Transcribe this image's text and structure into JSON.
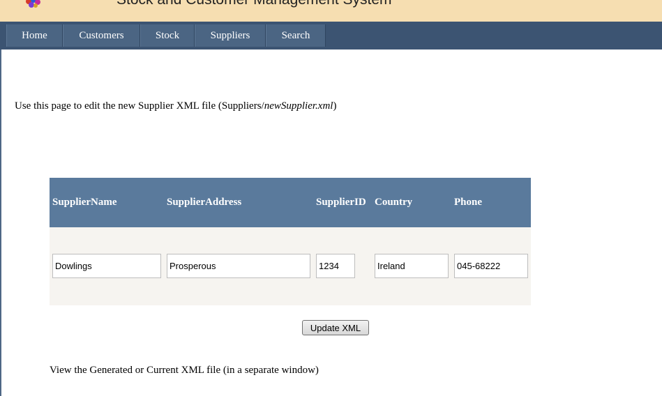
{
  "header": {
    "title": "Stock and Customer Management System",
    "logo_icon": "color-balls-logo-icon"
  },
  "nav": {
    "items": [
      {
        "label": "Home"
      },
      {
        "label": "Customers"
      },
      {
        "label": "Stock"
      },
      {
        "label": "Suppliers"
      },
      {
        "label": "Search"
      }
    ]
  },
  "intro": {
    "text": "Use this page to edit the new Supplier XML file (Suppliers/",
    "file": "newSupplier.xml",
    "suffix": ")"
  },
  "table": {
    "headers": [
      "SupplierName",
      "SupplierAddress",
      "SupplierID",
      "Country",
      "Phone"
    ],
    "row": {
      "supplier_name": "Dowlings",
      "supplier_address": "Prosperous",
      "supplier_id": "1234",
      "country": "Ireland",
      "phone": "045-68222"
    }
  },
  "actions": {
    "update_label": "Update XML"
  },
  "footer": {
    "text": "View the Generated or Current XML file (in a separate window)"
  },
  "colors": {
    "header_band": "#f6deb1",
    "navbar": "#3c5472",
    "table_head": "#5a7a9c",
    "table_body": "#f6f4f0"
  }
}
